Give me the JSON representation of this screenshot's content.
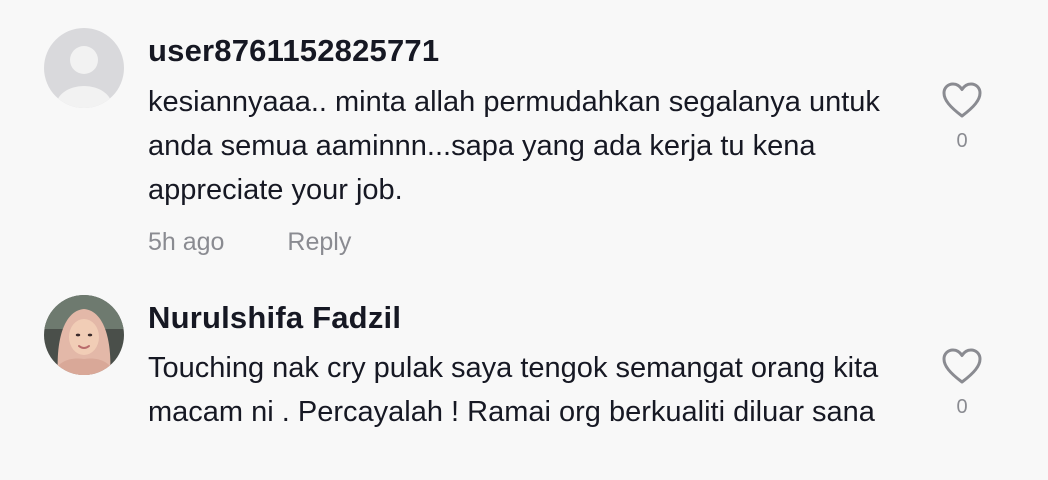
{
  "comments": [
    {
      "username": "user8761152825771",
      "text": "kesiannyaaa.. minta allah permudahkan segalanya untuk anda semua aaminnn...sapa yang ada kerja tu kena appreciate your job.",
      "time": "5h ago",
      "reply_label": "Reply",
      "like_count": "0",
      "avatar_icon": "default-user-avatar-icon",
      "like_icon": "heart-outline-icon"
    },
    {
      "username": "Nurulshifa Fadzil",
      "text": "Touching nak cry pulak saya tengok semangat orang kita macam ni . Percayalah ! Ramai org berkualiti diluar sana",
      "like_count": "0",
      "avatar_icon": "profile-photo-avatar",
      "like_icon": "heart-outline-icon"
    }
  ],
  "colors": {
    "background": "#f8f8f8",
    "primary_text": "#161823",
    "secondary_text": "#8a8b91"
  }
}
